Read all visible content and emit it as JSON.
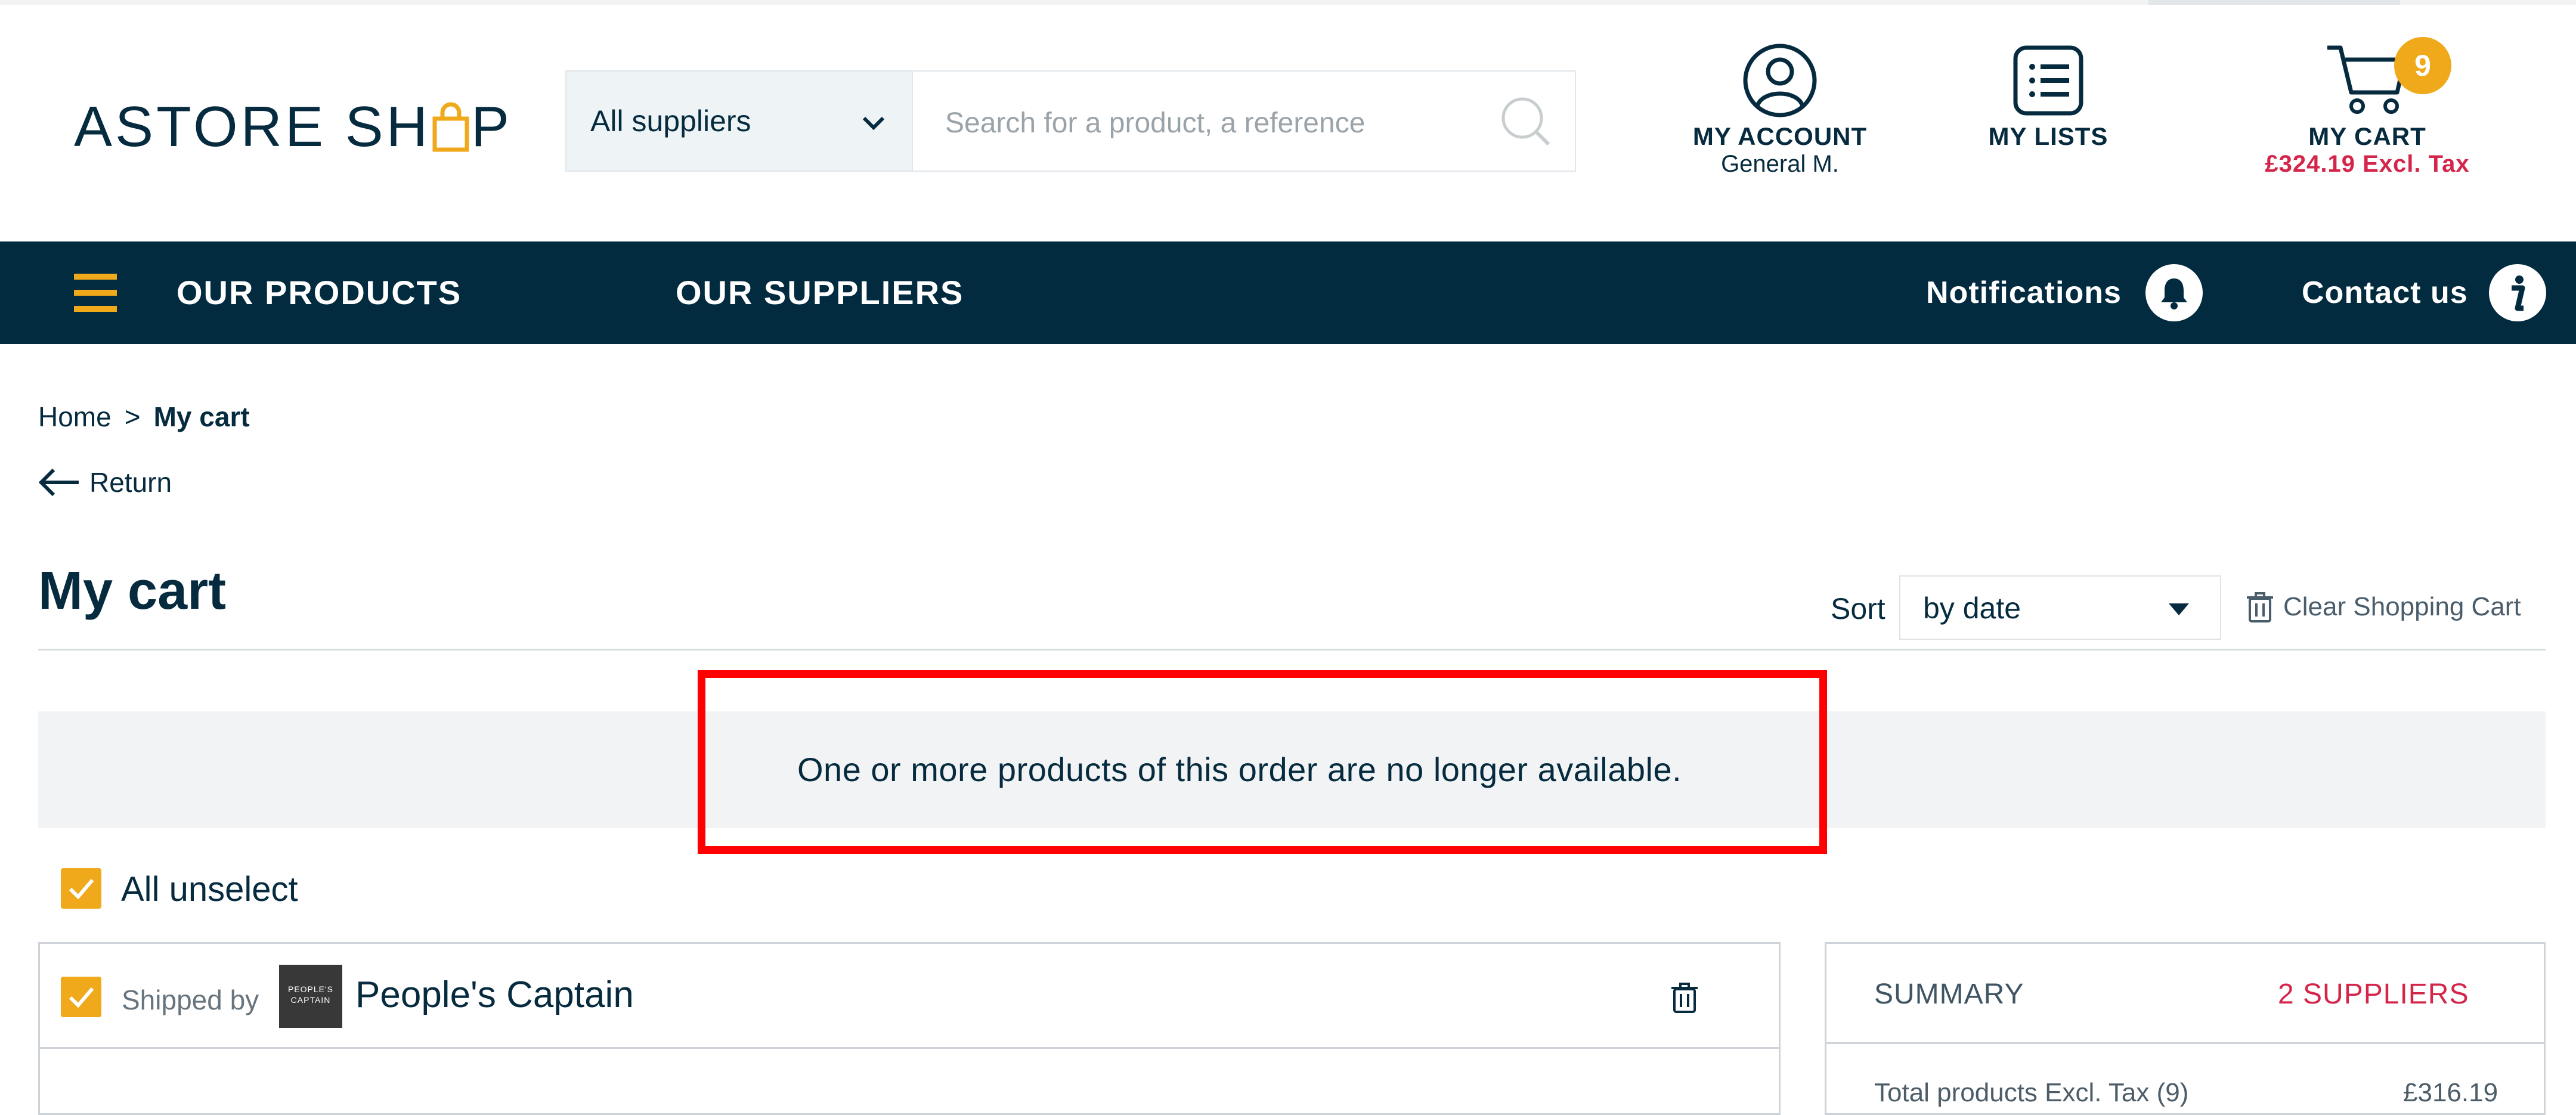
{
  "brand": {
    "logo_left": "ASTORE SH",
    "logo_right": "P"
  },
  "search": {
    "supplier_filter": "All suppliers",
    "placeholder": "Search for a product, a reference"
  },
  "header": {
    "account_label": "MY ACCOUNT",
    "account_user": "General M.",
    "lists_label": "MY LISTS",
    "cart_label": "MY CART",
    "cart_total": "£324.19 Excl. Tax",
    "cart_count": "9"
  },
  "nav": {
    "products": "OUR PRODUCTS",
    "suppliers": "OUR SUPPLIERS",
    "notifications": "Notifications",
    "contact": "Contact us"
  },
  "breadcrumb": {
    "home": "Home",
    "separator": ">",
    "current": "My cart"
  },
  "back_label": "Return",
  "page": {
    "title": "My cart",
    "sort_label": "Sort",
    "sort_value": "by date",
    "clear_label": "Clear Shopping Cart"
  },
  "alert": {
    "message": "One or more products of this order are no longer available."
  },
  "selection": {
    "all_label": "All unselect",
    "all_checked": true
  },
  "supplier_group": {
    "shipped_by": "Shipped by",
    "logo_text": "PEOPLE'S CAPTAIN",
    "name": "People's Captain",
    "checked": true
  },
  "summary": {
    "title": "SUMMARY",
    "suppliers_count": "2 SUPPLIERS",
    "row_label": "Total products Excl. Tax (9)",
    "row_value": "£316.19"
  },
  "colors": {
    "navy": "#022b40",
    "accent": "#efa91a",
    "price_red": "#d4264a",
    "alert_border": "#ff0000"
  }
}
